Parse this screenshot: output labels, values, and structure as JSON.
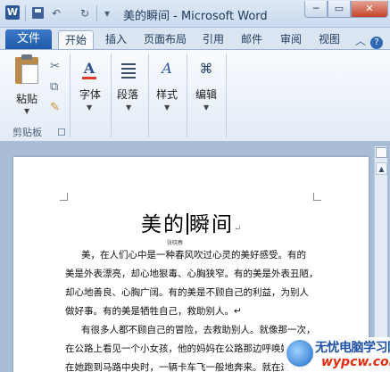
{
  "window": {
    "title": "美的瞬间 - Microsoft Word",
    "app_badge": "W",
    "controls": [
      "─",
      "▭",
      "✕"
    ]
  },
  "quick_access": {
    "undo": "↶",
    "redo": "↻",
    "customize": "▾"
  },
  "tabs": {
    "file": "文件",
    "items": [
      "开始",
      "插入",
      "页面布局",
      "引用",
      "邮件",
      "审阅",
      "视图"
    ],
    "active": "开始",
    "minimize_ribbon": "︿",
    "help": "?"
  },
  "ribbon": {
    "clipboard": {
      "paste": "粘贴",
      "group_label": "剪贴板",
      "cut_icon": "scissors-icon",
      "copy_icon": "copy-icon",
      "format_painter_icon": "brush-icon"
    },
    "font": {
      "label": "字体",
      "icon_glyph": "A"
    },
    "paragraph": {
      "label": "段落"
    },
    "styles": {
      "label": "样式",
      "icon_glyph": "A"
    },
    "editing": {
      "label": "编辑",
      "icon_glyph": "⌘"
    }
  },
  "document": {
    "title_before_cursor": "美的",
    "title_after_cursor": "瞬间",
    "paragraph_mark": "↵",
    "author": "张晓春",
    "lines": [
      "美，在人们心中是一种春风吹过心灵的美好感受。有的",
      "美是外表漂亮，却心地狠毒、心胸狭窄。有的美是外表丑陋，",
      "却心地善良、心胸广阔。有的美是不顾自己的利益，为别人",
      "做好事。有的美是牺牲自己，救助别人。↵",
      "有很多人都不顾自己的冒险，去救助别人。就像那一次，",
      "在公路上看见一个小女孩，他的妈妈在公路那边呼唤她，",
      "在她跑到马路中央时，一辆卡车飞一般地奔来。就在这千钧"
    ]
  },
  "scrollbar": {
    "up": "▲",
    "down": "▼"
  },
  "watermark": {
    "line1": "无忧电脑学习网",
    "line2": "wypcw.com"
  }
}
